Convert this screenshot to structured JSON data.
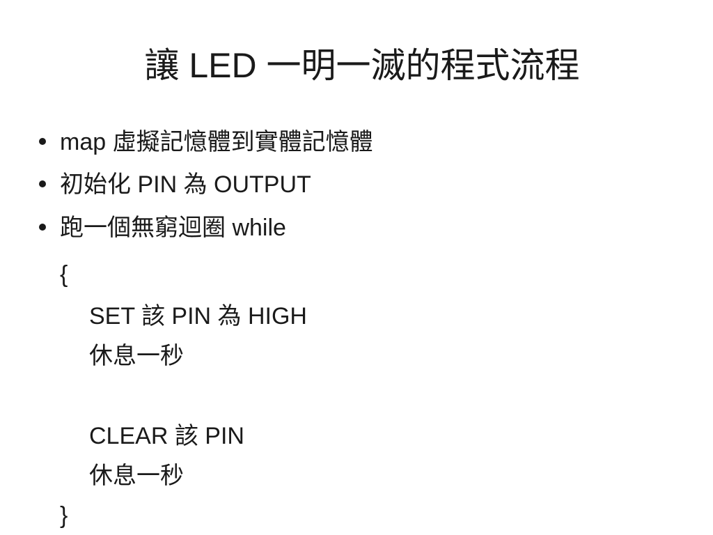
{
  "slide": {
    "title": "讓 LED 一明一滅的程式流程",
    "bullets": [
      "map 虛擬記憶體到實體記憶體",
      "初始化 PIN 為 OUTPUT",
      "跑一個無窮迴圈 while"
    ],
    "code": {
      "open_brace": "{",
      "set_high": "SET 該 PIN 為 HIGH",
      "sleep_1": "休息一秒",
      "clear_pin": "CLEAR 該 PIN",
      "sleep_2": "休息一秒",
      "close_brace": "}"
    }
  }
}
